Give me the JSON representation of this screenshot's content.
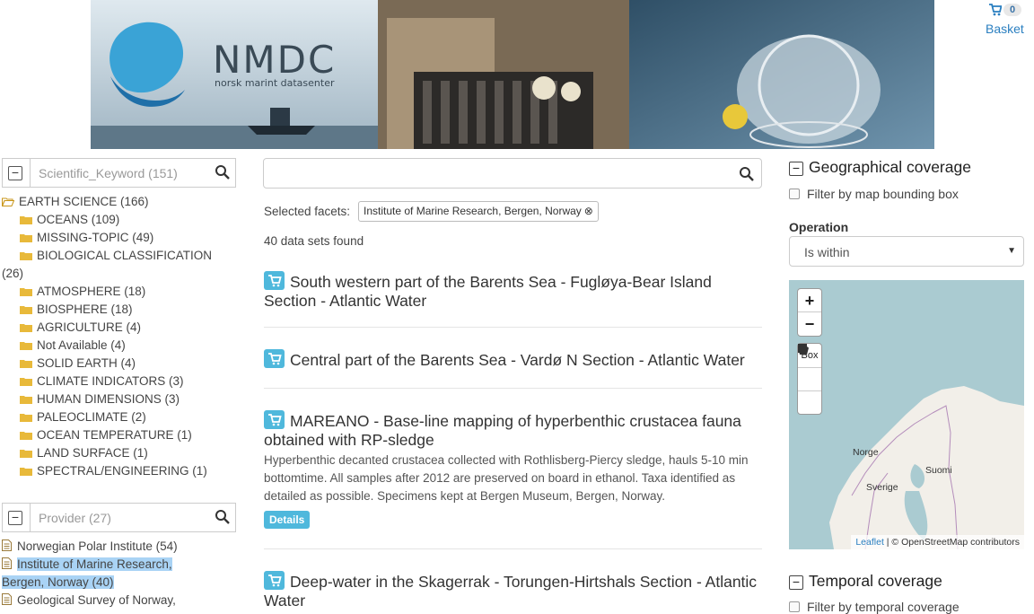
{
  "banner": {
    "logo_title": "NMDC",
    "logo_subtitle": "norsk marint datasenter"
  },
  "basket": {
    "count": "0",
    "label": "Basket",
    "icon": "shopping-cart-icon"
  },
  "keyword_facet": {
    "name": "Scientific_Keyword (151)",
    "root": "EARTH SCIENCE (166)",
    "items": [
      "OCEANS (109)",
      "MISSING-TOPIC (49)",
      "BIOLOGICAL CLASSIFICATION",
      "(26)",
      "ATMOSPHERE (18)",
      "BIOSPHERE (18)",
      "AGRICULTURE (4)",
      "Not Available (4)",
      "SOLID EARTH (4)",
      "CLIMATE INDICATORS (3)",
      "HUMAN DIMENSIONS (3)",
      "PALEOCLIMATE (2)",
      "OCEAN TEMPERATURE (1)",
      "LAND SURFACE (1)",
      "SPECTRAL/ENGINEERING (1)"
    ]
  },
  "provider_facet": {
    "name": "Provider (27)",
    "items": [
      {
        "line1": "Norwegian Polar Institute (54)",
        "line2": ""
      },
      {
        "line1": "Institute of Marine Research,",
        "line2": "Bergen, Norway (40)"
      },
      {
        "line1": "Geological Survey of Norway,",
        "line2": ""
      }
    ]
  },
  "search": {
    "placeholder": "",
    "value": ""
  },
  "selected_facets": {
    "label": "Selected facets:",
    "tag": "Institute of Marine Research, Bergen, Norway"
  },
  "results": {
    "count_text": "40 data sets found",
    "details_label": "Details",
    "items": [
      {
        "title": "South western part of the Barents Sea - Fugløya-Bear Island Section - Atlantic Water",
        "desc": ""
      },
      {
        "title": "Central part of the Barents Sea - Vardø N Section - Atlantic Water",
        "desc": ""
      },
      {
        "title": "MAREANO - Base-line mapping of hyperbenthic crustacea fauna obtained with RP-sledge",
        "desc": "Hyperbenthic decanted crustacea collected with Rothlisberg-Piercy sledge, hauls 5-10 min bottomtime. All samples after 2012 are preserved on board in ethanol. Taxa identified as detailed as possible. Specimens kept at Bergen Museum, Bergen, Norway."
      },
      {
        "title": "Deep-water in the Skagerrak - Torungen-Hirtshals Section - Atlantic Water",
        "desc": ""
      }
    ]
  },
  "geo": {
    "heading": "Geographical coverage",
    "filter_label": "Filter by map bounding box",
    "operation_label": "Operation",
    "operation_value": "Is within",
    "zoom_in": "+",
    "zoom_out": "−",
    "draw_box": "Box",
    "map_labels": {
      "norway": "Norge",
      "sweden": "Sverige",
      "finland": "Suomi"
    },
    "attribution_link": "Leaflet",
    "attribution_text": " | © OpenStreetMap contributors"
  },
  "temporal": {
    "heading": "Temporal coverage",
    "filter_label": "Filter by temporal coverage"
  },
  "colors": {
    "accent": "#4fb8dc",
    "link": "#2a7fc0",
    "highlight": "#a9d3f5",
    "folder": "#e8b93a"
  }
}
